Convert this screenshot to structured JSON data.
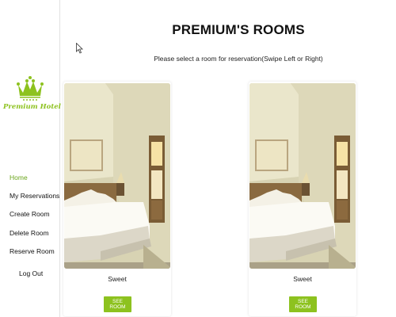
{
  "brand": {
    "name": "Premium Hotel",
    "accent_color": "#8dc21f",
    "logo_icon": "crown-icon"
  },
  "sidebar": {
    "items": [
      {
        "label": "Home",
        "active": true
      },
      {
        "label": "My Reservations",
        "active": false
      },
      {
        "label": "Create Room",
        "active": false
      },
      {
        "label": "Delete Room",
        "active": false
      },
      {
        "label": "Reserve Room",
        "active": false
      },
      {
        "label": "Log Out",
        "active": false
      }
    ]
  },
  "main": {
    "title": "PREMIUM'S ROOMS",
    "subtitle": "Please select a room for reservation(Swipe Left or Right)",
    "rooms": [
      {
        "name": "Sweet",
        "button_label": "SEE ROOM",
        "image": "bedroom-photo"
      },
      {
        "name": "Sweet",
        "button_label": "SEE ROOM",
        "image": "bedroom-photo"
      }
    ]
  }
}
